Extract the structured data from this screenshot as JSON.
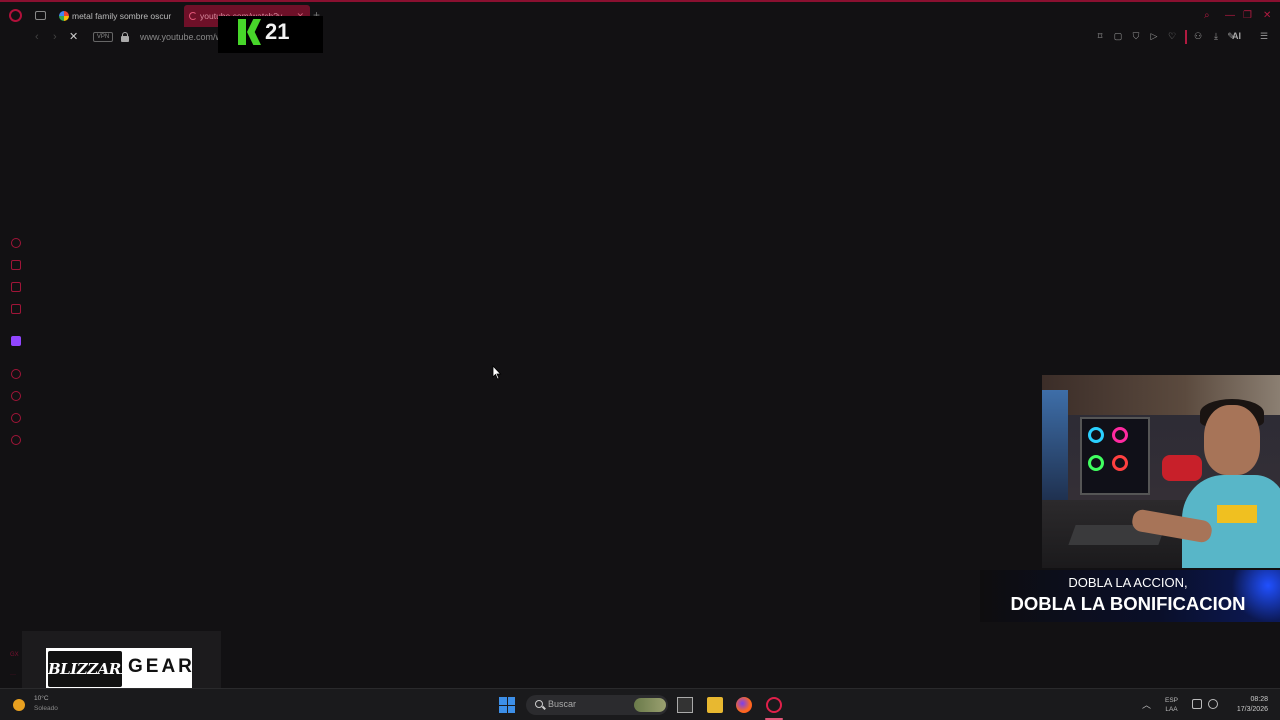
{
  "browser": {
    "tabs": [
      {
        "title": "metal family sombre oscur",
        "active": false
      },
      {
        "title": "youtube.com/watch?v",
        "active": true
      }
    ],
    "address": {
      "vpn_label": "VPN",
      "url": "www.youtube.com/wat"
    },
    "toolbar": {
      "ai_label": "AI"
    },
    "accent_color": "#b0103a"
  },
  "overlays": {
    "k21_number": "21",
    "banner": {
      "line1": "DOBLA LA ACCION,",
      "line2": "DOBLA LA BONIFICACION"
    },
    "sponsor": {
      "logo": "BLIZZARD",
      "suffix": "GEAR"
    }
  },
  "taskbar": {
    "weather": {
      "temp": "10°C",
      "condition": "Soleado"
    },
    "search_placeholder": "Buscar",
    "lang": {
      "line1": "ESP",
      "line2": "LAA"
    },
    "clock": {
      "time": "08:28",
      "date": "17/3/2026"
    }
  }
}
